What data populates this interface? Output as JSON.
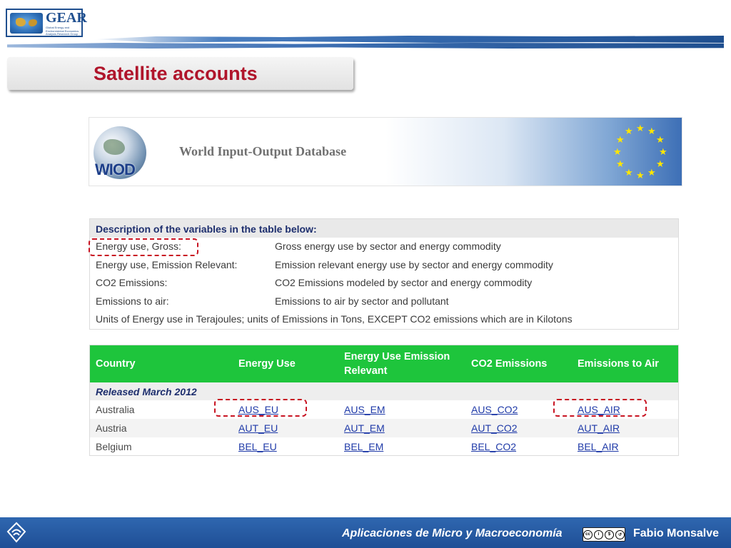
{
  "header": {
    "logo_text": "GEAR",
    "logo_sub": "Global Energy and Environmental Economics Analysis Research Group",
    "slide_title": "Satellite accounts"
  },
  "wiod": {
    "logo_letters": "WIOD",
    "title": "World Input-Output Database"
  },
  "description": {
    "heading": "Description of the variables in the table below:",
    "rows": [
      {
        "key": "Energy use, Gross:",
        "value": "Gross energy use by sector and energy commodity"
      },
      {
        "key": "Energy use, Emission Relevant:",
        "value": "Emission relevant energy use by sector and energy commodity"
      },
      {
        "key": "CO2 Emissions:",
        "value": "CO2 Emissions modeled by sector and energy commodity"
      },
      {
        "key": "Emissions to air:",
        "value": "Emissions to air by sector and pollutant"
      }
    ],
    "units_note": "Units of Energy use in Terajoules; units of Emissions in Tons, EXCEPT CO2 emissions which are in Kilotons"
  },
  "table": {
    "columns": [
      "Country",
      "Energy Use",
      "Energy Use Emission Relevant",
      "CO2 Emissions",
      "Emissions to Air"
    ],
    "release_label": "Released March 2012",
    "rows": [
      {
        "country": "Australia",
        "eu": "AUS_EU",
        "em": "AUS_EM",
        "co2": "AUS_CO2",
        "air": "AUS_AIR"
      },
      {
        "country": "Austria",
        "eu": "AUT_EU",
        "em": "AUT_EM",
        "co2": "AUT_CO2",
        "air": "AUT_AIR"
      },
      {
        "country": "Belgium",
        "eu": "BEL_EU",
        "em": "BEL_EM",
        "co2": "BEL_CO2",
        "air": "BEL_AIR"
      }
    ]
  },
  "footer": {
    "course": "Aplicaciones de Micro y Macroeconomía",
    "license": "cc by nc sa",
    "author": "Fabio Monsalve"
  },
  "colors": {
    "title_red": "#b0152b",
    "table_green": "#1ec53c",
    "link_blue": "#1f3aa8",
    "footer_blue": "#2f67b0",
    "highlight_dash": "#c81422"
  }
}
